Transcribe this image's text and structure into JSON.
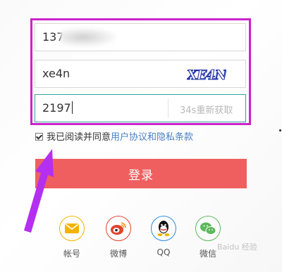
{
  "form": {
    "phone_value": "137",
    "captcha_input_value": "xe4n",
    "captcha_image_text": "XE4N",
    "sms_code_value": "2197",
    "sms_resend_label": "34s重新获取"
  },
  "agreement": {
    "checked": true,
    "prefix": "我已阅读并同意",
    "link_text": "用户协议和隐私条款"
  },
  "login": {
    "label": "登录"
  },
  "social": [
    {
      "label": "帐号",
      "icon": "mail-icon",
      "color": "#f2b400"
    },
    {
      "label": "微博",
      "icon": "weibo-icon",
      "color": "#e0432e"
    },
    {
      "label": "QQ",
      "icon": "qq-icon",
      "color": "#2a8de0"
    },
    {
      "label": "微信",
      "icon": "wechat-icon",
      "color": "#5cb85c"
    }
  ],
  "annotation": {
    "frame_color": "#cc22cc",
    "arrow_color": "#b52ff0"
  },
  "watermark": {
    "text": "Baidu 经验"
  }
}
